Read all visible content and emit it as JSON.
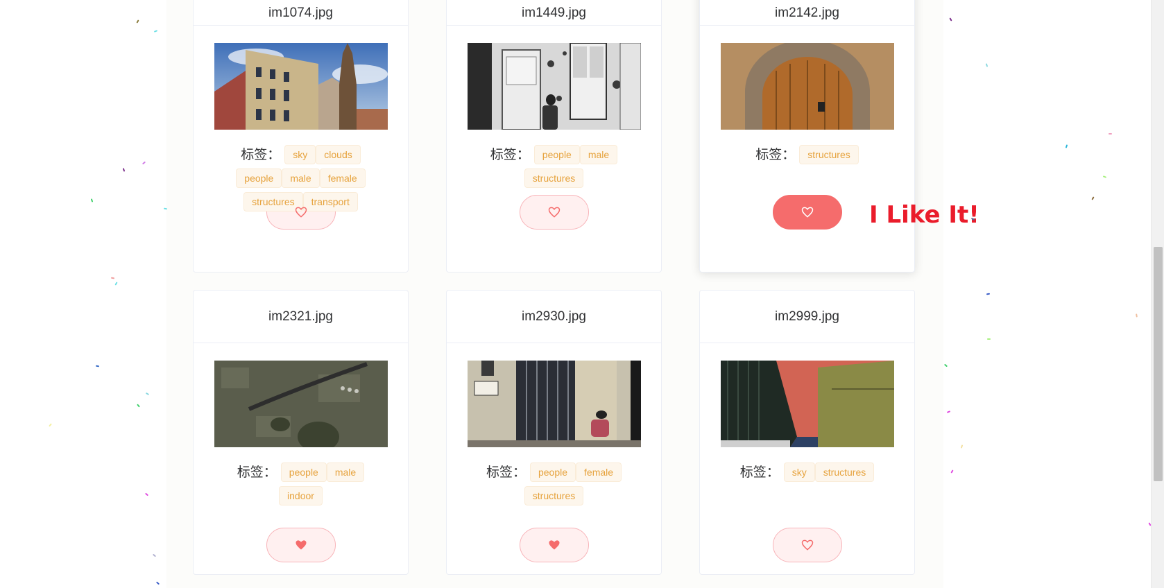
{
  "tag_prefix": "标签：",
  "like_popup_text": "I Like It!",
  "colors": {
    "tag_text": "#e6a23c",
    "tag_bg": "#fdf6ec",
    "like_active": "#f56c6c",
    "heart_stroke": "#f56c6c",
    "popup_text": "#ea1c2b"
  },
  "cards": [
    {
      "file_name": "im1074.jpg",
      "tags": [
        "sky",
        "clouds",
        "people",
        "male",
        "female",
        "structures",
        "transport"
      ],
      "liked": false,
      "icon": "heart-outline-icon"
    },
    {
      "file_name": "im1449.jpg",
      "tags": [
        "people",
        "male",
        "structures"
      ],
      "liked": false,
      "icon": "heart-outline-icon"
    },
    {
      "file_name": "im2142.jpg",
      "tags": [
        "structures"
      ],
      "liked": false,
      "button_state": "hover-active",
      "icon": "heart-outline-icon"
    },
    {
      "file_name": "im2321.jpg",
      "tags": [
        "people",
        "male",
        "indoor"
      ],
      "liked": true,
      "icon": "heart-filled-icon"
    },
    {
      "file_name": "im2930.jpg",
      "tags": [
        "people",
        "female",
        "structures"
      ],
      "liked": true,
      "icon": "heart-filled-icon"
    },
    {
      "file_name": "im2999.jpg",
      "tags": [
        "sky",
        "structures"
      ],
      "liked": false,
      "icon": "heart-outline-icon"
    }
  ]
}
